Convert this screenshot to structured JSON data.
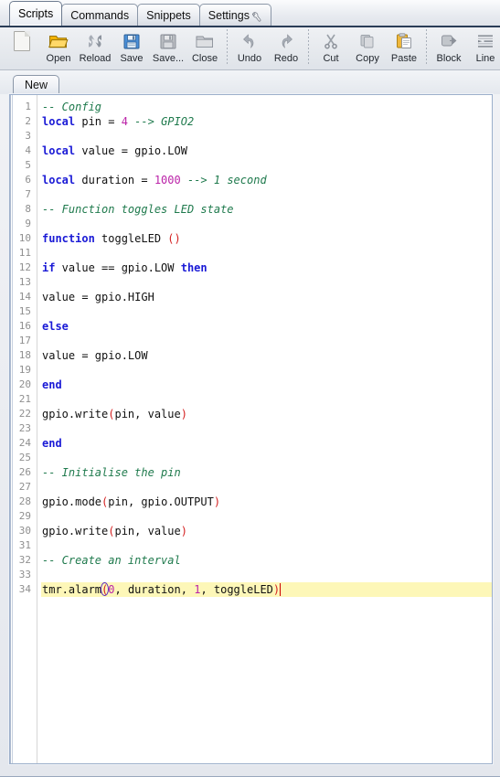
{
  "window": {
    "tabs": [
      {
        "label": "Scripts",
        "active": true,
        "icon": null
      },
      {
        "label": "Commands",
        "active": false,
        "icon": null
      },
      {
        "label": "Snippets",
        "active": false,
        "icon": null
      },
      {
        "label": "Settings",
        "active": false,
        "icon": "wrench-icon"
      }
    ]
  },
  "toolbar": {
    "buttons": [
      {
        "label": "",
        "icon": "new-document-icon",
        "name": "new-button"
      },
      {
        "label": "Open",
        "icon": "open-folder-icon",
        "name": "open-button"
      },
      {
        "label": "Reload",
        "icon": "reload-icon",
        "name": "reload-button"
      },
      {
        "label": "Save",
        "icon": "floppy-disk-icon",
        "name": "save-button"
      },
      {
        "label": "Save...",
        "icon": "save-as-icon",
        "name": "save-as-button"
      },
      {
        "label": "Close",
        "icon": "close-folder-icon",
        "name": "close-button"
      },
      {
        "label": "Undo",
        "icon": "undo-arrow-icon",
        "name": "undo-button"
      },
      {
        "label": "Redo",
        "icon": "redo-arrow-icon",
        "name": "redo-button"
      },
      {
        "label": "Cut",
        "icon": "scissors-icon",
        "name": "cut-button"
      },
      {
        "label": "Copy",
        "icon": "copy-icon",
        "name": "copy-button"
      },
      {
        "label": "Paste",
        "icon": "clipboard-paste-icon",
        "name": "paste-button"
      },
      {
        "label": "Block",
        "icon": "block-indent-icon",
        "name": "block-button"
      },
      {
        "label": "Line",
        "icon": "line-indent-icon",
        "name": "line-button"
      }
    ]
  },
  "file_tabs": [
    {
      "label": "New",
      "active": true
    }
  ],
  "editor": {
    "total_lines": 34,
    "highlighted_line": 34,
    "cursor_line": 34,
    "lines": [
      {
        "n": 1,
        "tokens": [
          {
            "t": "-- Config",
            "c": "com"
          }
        ]
      },
      {
        "n": 2,
        "tokens": [
          {
            "t": "local",
            "c": "kw"
          },
          {
            "t": " pin = ",
            "c": "pl"
          },
          {
            "t": "4",
            "c": "num"
          },
          {
            "t": " ",
            "c": "pl"
          },
          {
            "t": "--> GPIO2",
            "c": "com"
          }
        ]
      },
      {
        "n": 3,
        "tokens": []
      },
      {
        "n": 4,
        "tokens": [
          {
            "t": "local",
            "c": "kw"
          },
          {
            "t": " value = gpio.LOW",
            "c": "pl"
          }
        ]
      },
      {
        "n": 5,
        "tokens": []
      },
      {
        "n": 6,
        "tokens": [
          {
            "t": "local",
            "c": "kw"
          },
          {
            "t": " duration = ",
            "c": "pl"
          },
          {
            "t": "1000",
            "c": "num"
          },
          {
            "t": " ",
            "c": "pl"
          },
          {
            "t": "--> 1 second",
            "c": "com"
          }
        ]
      },
      {
        "n": 7,
        "tokens": []
      },
      {
        "n": 8,
        "tokens": [
          {
            "t": "-- Function toggles LED state",
            "c": "com"
          }
        ]
      },
      {
        "n": 9,
        "tokens": []
      },
      {
        "n": 10,
        "tokens": [
          {
            "t": "function",
            "c": "kw"
          },
          {
            "t": " toggleLED ",
            "c": "pl"
          },
          {
            "t": "()",
            "c": "par"
          }
        ]
      },
      {
        "n": 11,
        "tokens": []
      },
      {
        "n": 12,
        "tokens": [
          {
            "t": "if",
            "c": "kw"
          },
          {
            "t": " value == gpio.LOW ",
            "c": "pl"
          },
          {
            "t": "then",
            "c": "kw"
          }
        ]
      },
      {
        "n": 13,
        "tokens": []
      },
      {
        "n": 14,
        "tokens": [
          {
            "t": "value = gpio.HIGH",
            "c": "pl"
          }
        ]
      },
      {
        "n": 15,
        "tokens": []
      },
      {
        "n": 16,
        "tokens": [
          {
            "t": "else",
            "c": "kw"
          }
        ]
      },
      {
        "n": 17,
        "tokens": []
      },
      {
        "n": 18,
        "tokens": [
          {
            "t": "value = gpio.LOW",
            "c": "pl"
          }
        ]
      },
      {
        "n": 19,
        "tokens": []
      },
      {
        "n": 20,
        "tokens": [
          {
            "t": "end",
            "c": "kw"
          }
        ]
      },
      {
        "n": 21,
        "tokens": []
      },
      {
        "n": 22,
        "tokens": [
          {
            "t": "gpio.write",
            "c": "pl"
          },
          {
            "t": "(",
            "c": "par"
          },
          {
            "t": "pin, value",
            "c": "pl"
          },
          {
            "t": ")",
            "c": "par"
          }
        ]
      },
      {
        "n": 23,
        "tokens": []
      },
      {
        "n": 24,
        "tokens": [
          {
            "t": "end",
            "c": "kw"
          }
        ]
      },
      {
        "n": 25,
        "tokens": []
      },
      {
        "n": 26,
        "tokens": [
          {
            "t": "-- Initialise the pin",
            "c": "com"
          }
        ]
      },
      {
        "n": 27,
        "tokens": []
      },
      {
        "n": 28,
        "tokens": [
          {
            "t": "gpio.mode",
            "c": "pl"
          },
          {
            "t": "(",
            "c": "par"
          },
          {
            "t": "pin, gpio.OUTPUT",
            "c": "pl"
          },
          {
            "t": ")",
            "c": "par"
          }
        ]
      },
      {
        "n": 29,
        "tokens": []
      },
      {
        "n": 30,
        "tokens": [
          {
            "t": "gpio.write",
            "c": "pl"
          },
          {
            "t": "(",
            "c": "par"
          },
          {
            "t": "pin, value",
            "c": "pl"
          },
          {
            "t": ")",
            "c": "par"
          }
        ]
      },
      {
        "n": 31,
        "tokens": []
      },
      {
        "n": 32,
        "tokens": [
          {
            "t": "-- Create an interval",
            "c": "com"
          }
        ]
      },
      {
        "n": 33,
        "tokens": []
      },
      {
        "n": 34,
        "hl": true,
        "caret": true,
        "tokens": [
          {
            "t": "tmr.alarm",
            "c": "pl"
          },
          {
            "t": "(",
            "c": "brace"
          },
          {
            "t": "0",
            "c": "num"
          },
          {
            "t": ", duration, ",
            "c": "pl"
          },
          {
            "t": "1",
            "c": "num"
          },
          {
            "t": ", toggleLED",
            "c": "pl"
          },
          {
            "t": ")",
            "c": "par"
          }
        ]
      }
    ]
  },
  "colors": {
    "comment": "#1f7a4d",
    "keyword": "#1a1ad6",
    "number": "#bb23a8",
    "paren": "#d42020",
    "highlight_line": "#fdf7b8",
    "caret": "#cc0000",
    "brace_match_outline": "#5b2bbf",
    "gutter_text": "#8f8f8f",
    "editor_border": "#9db0cb"
  }
}
